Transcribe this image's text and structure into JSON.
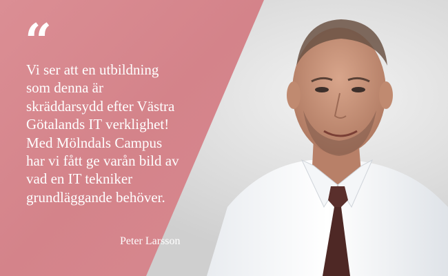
{
  "quote": {
    "mark": "“",
    "lines": [
      "Vi ser att en utbildning",
      "som denna är",
      "skräddarsydd efter Västra",
      "Götalands IT verklighet!",
      "Med Mölndals Campus",
      "har vi fått ge varån bild av",
      "vad en IT tekniker",
      "grundläggande behöver."
    ],
    "author": "Peter Larsson"
  },
  "colors": {
    "panel": "#d9868d",
    "text": "#ffffff",
    "background": "#e3e3e3",
    "shirt": "#ffffff",
    "tie": "#5a2f2c",
    "skin": "#c99479"
  },
  "image": {
    "subject_icon": "portrait-photo"
  }
}
